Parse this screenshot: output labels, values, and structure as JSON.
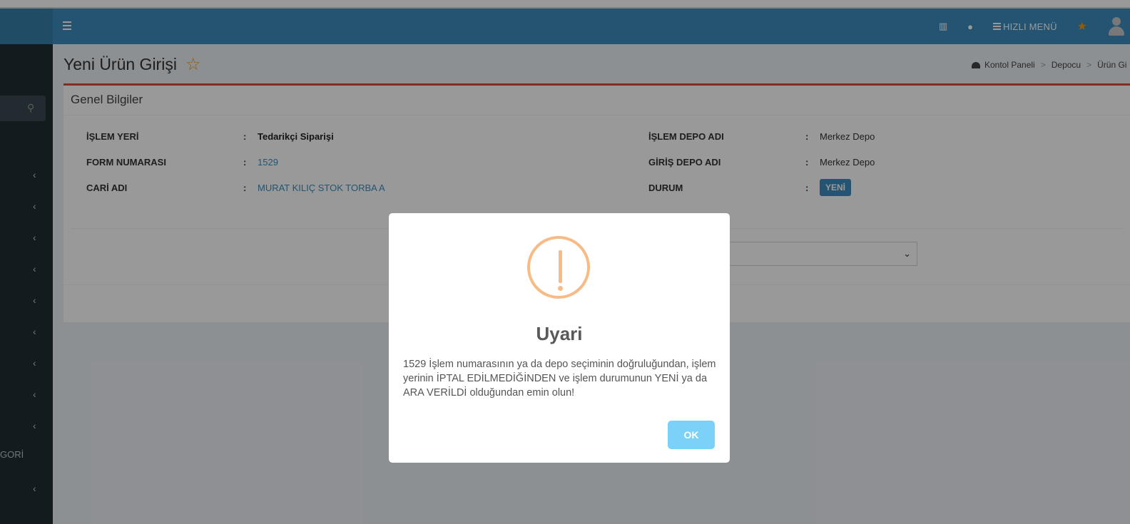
{
  "navbar": {
    "quick_menu_label": "HIZLI MENÜ"
  },
  "page": {
    "title": "Yeni Ürün Girişi"
  },
  "breadcrumb": {
    "items": [
      "Kontol Paneli",
      "Depocu",
      "Ürün Gi"
    ],
    "separator": ">"
  },
  "sidebar": {
    "visible_label": "GORİ"
  },
  "box": {
    "header": "Genel Bilgiler",
    "colon": ":",
    "left_fields": [
      {
        "label": "İŞLEM YERİ",
        "value": "Tedarikçi Siparişi"
      },
      {
        "label": "FORM NUMARASI",
        "value": "1529"
      },
      {
        "label": "CARİ ADI",
        "value": "MURAT KILIÇ STOK TORBA A"
      }
    ],
    "right_fields": [
      {
        "label": "İŞLEM DEPO ADI",
        "value": "Merkez Depo"
      },
      {
        "label": "GİRİŞ DEPO ADI",
        "value": "Merkez Depo"
      },
      {
        "label": "DURUM",
        "value": "YENİ"
      }
    ]
  },
  "modal": {
    "title": "Uyari",
    "text": "1529 İşlem numarasının ya da depo seçiminin doğruluğundan, işlem yerinin İPTAL EDİLMEDİĞİNDEN ve işlem durumunun YENİ ya da ARA VERİLDİ olduğundan emin olun!",
    "ok_label": "OK"
  },
  "colors": {
    "navbar": "#3c8dbc",
    "sidebar": "#222d32",
    "box_accent": "#dd4b39",
    "warning_icon": "#f8bb86",
    "ok_button": "#7cd1f9"
  }
}
